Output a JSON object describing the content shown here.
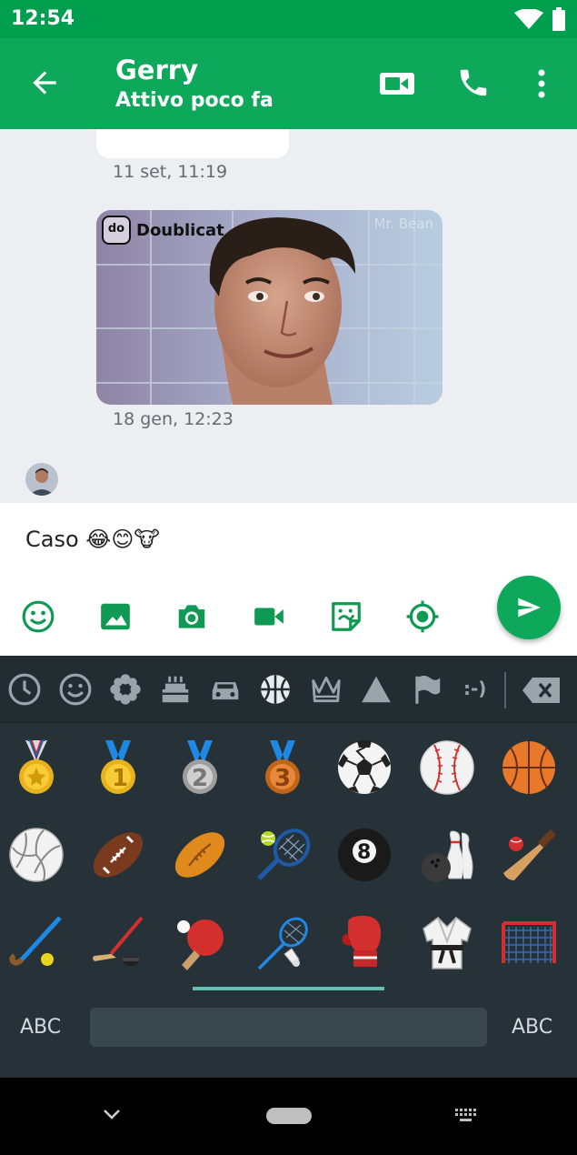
{
  "status_bar": {
    "time": "12:54",
    "icons": [
      "wifi-icon",
      "battery-icon"
    ]
  },
  "header": {
    "contact_name": "Gerry",
    "contact_status": "Attivo poco fa",
    "icons": [
      "back-arrow-icon",
      "video-call-icon",
      "phone-icon",
      "more-vert-icon"
    ]
  },
  "chat": {
    "messages": [
      {
        "type": "text",
        "timestamp": "11 set, 11:19"
      },
      {
        "type": "gif",
        "brand": "Doublicat",
        "watermark": "Mr. Bean",
        "timestamp": "18 gen, 12:23"
      }
    ]
  },
  "composer": {
    "text": "Caso 😂😊🐮",
    "tools": [
      "emoji-icon",
      "image-icon",
      "camera-icon",
      "video-icon",
      "sticker-icon",
      "location-icon"
    ]
  },
  "keyboard": {
    "categories": [
      "recent",
      "smileys",
      "nature",
      "food",
      "travel",
      "activities",
      "objects",
      "symbols",
      "flags",
      "emoticons"
    ],
    "selected_category": "activities",
    "emojis": [
      "🎖️",
      "🥇",
      "🥈",
      "🥉",
      "⚽",
      "⚾",
      "🏀",
      "🏐",
      "🏈",
      "🏉",
      "🎾",
      "🎱",
      "🎳",
      "🏏",
      "🏑",
      "🏒",
      "🏓",
      "🏸",
      "🥊",
      "🥋",
      "🥅"
    ],
    "abc_left": "ABC",
    "abc_right": "ABC"
  },
  "colors": {
    "primary": "#0da859",
    "status_bar": "#009e4f",
    "chat_bg": "#eceef1",
    "keyboard_bg": "#263238",
    "indicator": "#5fbfb5"
  }
}
